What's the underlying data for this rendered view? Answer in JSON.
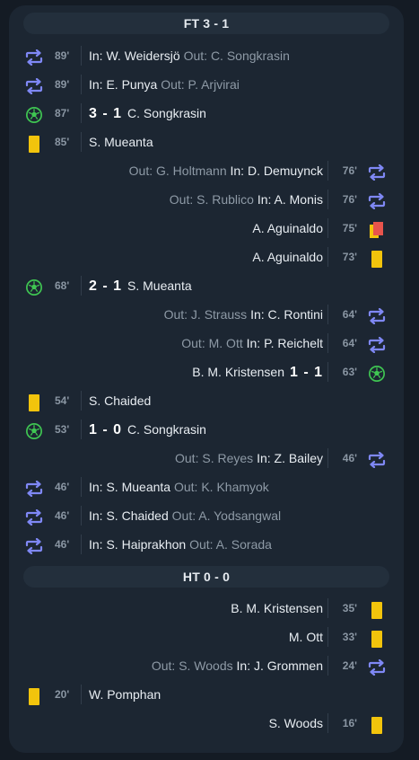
{
  "ft_label": "FT 3 - 1",
  "ht_label": "HT 0 - 0",
  "colors": {
    "background": "#141b24",
    "card": "#1c2632",
    "substitution": "#7f88f5",
    "goal": "#3fc552",
    "yellow_card": "#f2c40c",
    "red_card": "#e8544c"
  },
  "second_half": [
    {
      "side": "left",
      "type": "sub",
      "minute": "89'",
      "in_label": "In:",
      "in_player": "W. Weidersjö",
      "out_label": "Out:",
      "out_player": "C. Songkrasin"
    },
    {
      "side": "left",
      "type": "sub",
      "minute": "89'",
      "in_label": "In:",
      "in_player": "E. Punya",
      "out_label": "Out:",
      "out_player": "P. Arjvirai"
    },
    {
      "side": "left",
      "type": "goal",
      "minute": "87'",
      "score": "3 - 1",
      "player": "C. Songkrasin"
    },
    {
      "side": "left",
      "type": "yellow",
      "minute": "85'",
      "player": "S. Mueanta"
    },
    {
      "side": "right",
      "type": "sub",
      "minute": "76'",
      "out_label": "Out:",
      "out_player": "G. Holtmann",
      "in_label": "In:",
      "in_player": "D. Demuynck"
    },
    {
      "side": "right",
      "type": "sub",
      "minute": "76'",
      "out_label": "Out:",
      "out_player": "S. Rublico",
      "in_label": "In:",
      "in_player": "A. Monis"
    },
    {
      "side": "right",
      "type": "second-yellow",
      "minute": "75'",
      "player": "A. Aguinaldo"
    },
    {
      "side": "right",
      "type": "yellow",
      "minute": "73'",
      "player": "A. Aguinaldo"
    },
    {
      "side": "left",
      "type": "goal",
      "minute": "68'",
      "score": "2 - 1",
      "player": "S. Mueanta"
    },
    {
      "side": "right",
      "type": "sub",
      "minute": "64'",
      "out_label": "Out:",
      "out_player": "J. Strauss",
      "in_label": "In:",
      "in_player": "C. Rontini"
    },
    {
      "side": "right",
      "type": "sub",
      "minute": "64'",
      "out_label": "Out:",
      "out_player": "M. Ott",
      "in_label": "In:",
      "in_player": "P. Reichelt"
    },
    {
      "side": "right",
      "type": "goal",
      "minute": "63'",
      "score": "1 - 1",
      "player": "B. M. Kristensen"
    },
    {
      "side": "left",
      "type": "yellow",
      "minute": "54'",
      "player": "S. Chaided"
    },
    {
      "side": "left",
      "type": "goal",
      "minute": "53'",
      "score": "1 - 0",
      "player": "C. Songkrasin"
    },
    {
      "side": "right",
      "type": "sub",
      "minute": "46'",
      "out_label": "Out:",
      "out_player": "S. Reyes",
      "in_label": "In:",
      "in_player": "Z. Bailey"
    },
    {
      "side": "left",
      "type": "sub",
      "minute": "46'",
      "in_label": "In:",
      "in_player": "S. Mueanta",
      "out_label": "Out:",
      "out_player": "K. Khamyok"
    },
    {
      "side": "left",
      "type": "sub",
      "minute": "46'",
      "in_label": "In:",
      "in_player": "S. Chaided",
      "out_label": "Out:",
      "out_player": "A. Yodsangwal"
    },
    {
      "side": "left",
      "type": "sub",
      "minute": "46'",
      "in_label": "In:",
      "in_player": "S. Haiprakhon",
      "out_label": "Out:",
      "out_player": "A. Sorada"
    }
  ],
  "first_half": [
    {
      "side": "right",
      "type": "yellow",
      "minute": "35'",
      "player": "B. M. Kristensen"
    },
    {
      "side": "right",
      "type": "yellow",
      "minute": "33'",
      "player": "M. Ott"
    },
    {
      "side": "right",
      "type": "sub",
      "minute": "24'",
      "out_label": "Out:",
      "out_player": "S. Woods",
      "in_label": "In:",
      "in_player": "J. Grommen"
    },
    {
      "side": "left",
      "type": "yellow",
      "minute": "20'",
      "player": "W. Pomphan"
    },
    {
      "side": "right",
      "type": "yellow",
      "minute": "16'",
      "player": "S. Woods"
    }
  ]
}
